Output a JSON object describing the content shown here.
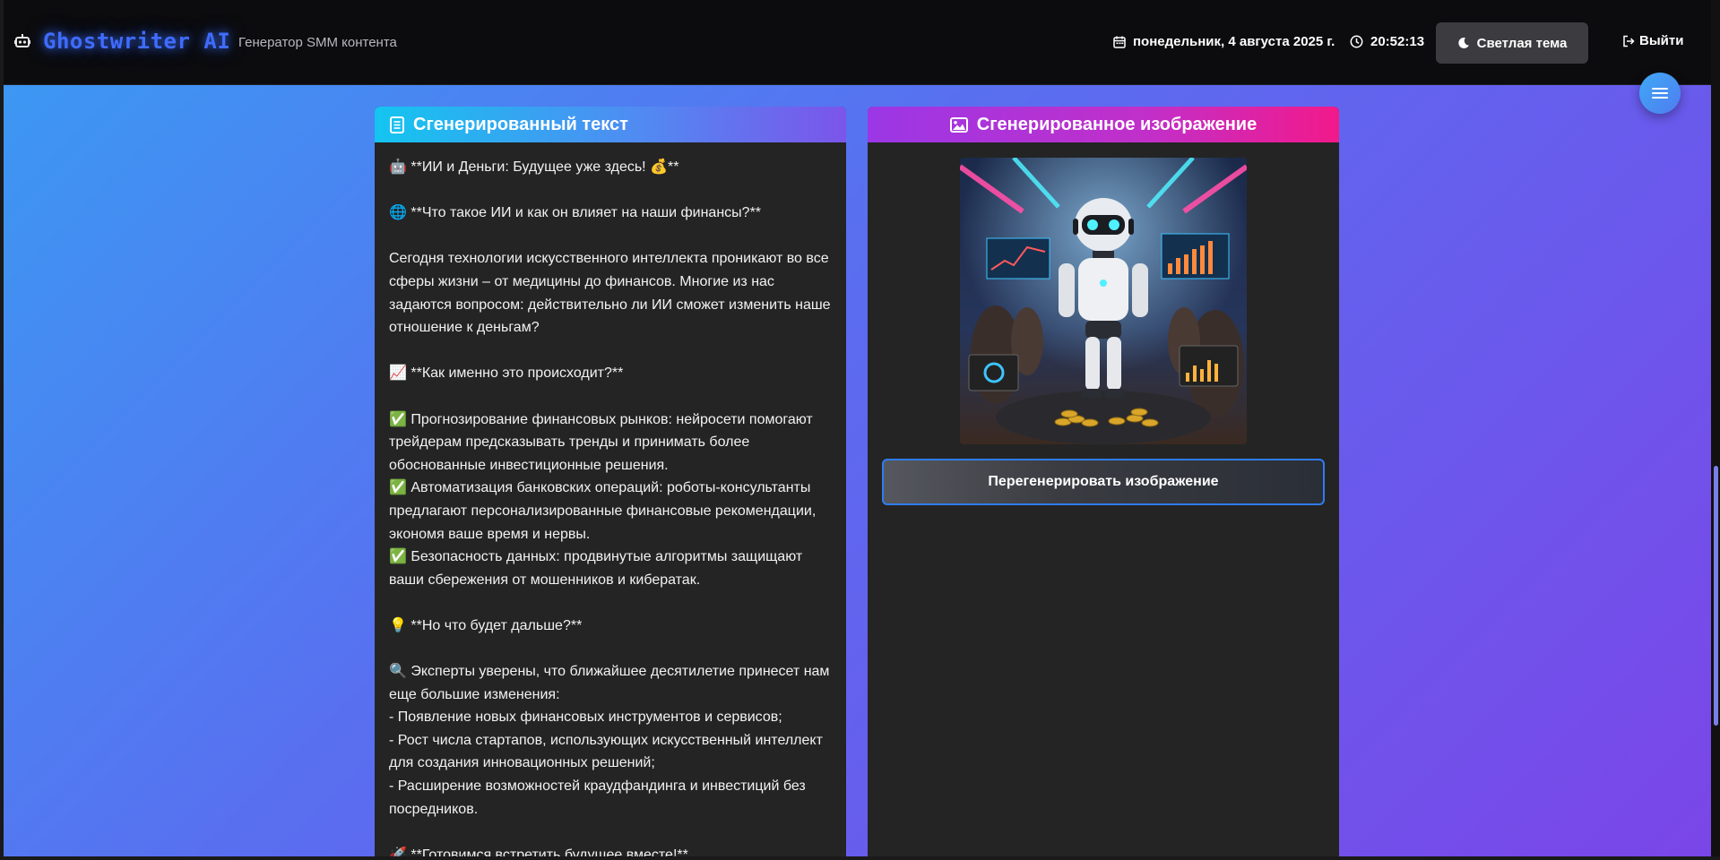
{
  "header": {
    "brand": "Ghostwriter AI",
    "subtitle": "Генератор SMM контента",
    "date": "понедельник, 4 августа 2025 г.",
    "time": "20:52:13",
    "theme_button": "Светлая тема",
    "logout_button": "Выйти"
  },
  "text_card": {
    "title": "Сгенерированный текст",
    "content": "🤖 **ИИ и Деньги: Будущее уже здесь! 💰**\n\n🌐 **Что такое ИИ и как он влияет на наши финансы?**\n\nСегодня технологии искусственного интеллекта проникают во все сферы жизни – от медицины до финансов. Многие из нас задаются вопросом: действительно ли ИИ сможет изменить наше отношение к деньгам?\n\n📈 **Как именно это происходит?**\n\n✅ Прогнозирование финансовых рынков: нейросети помогают трейдерам предсказывать тренды и принимать более обоснованные инвестиционные решения.\n✅ Автоматизация банковских операций: роботы-консультанты предлагают персонализированные финансовые рекомендации, экономя ваше время и нервы.\n✅ Безопасность данных: продвинутые алгоритмы защищают ваши сбережения от мошенников и кибератак.\n\n💡 **Но что будет дальше?**\n\n🔍 Эксперты уверены, что ближайшее десятилетие принесет нам еще большие изменения:\n- Появление новых финансовых инструментов и сервисов;\n- Рост числа стартапов, использующих искусственный интеллект для создания инновационных решений;\n- Расширение возможностей краудфандинга и инвестиций без посредников.\n\n🚀 **Готовимся встретить будущее вместе!**"
  },
  "image_card": {
    "title": "Сгенерированное изображение",
    "regenerate_button": "Перегенерировать изображение"
  },
  "colors": {
    "brand": "#3f6cff",
    "accent_blue": "#2f7cf5",
    "header_bg": "#0c0c0e",
    "card_bg": "#242424"
  },
  "icons": [
    "robot-icon",
    "calendar-icon",
    "clock-icon",
    "moon-icon",
    "logout-icon",
    "menu-icon",
    "document-icon",
    "image-icon"
  ]
}
